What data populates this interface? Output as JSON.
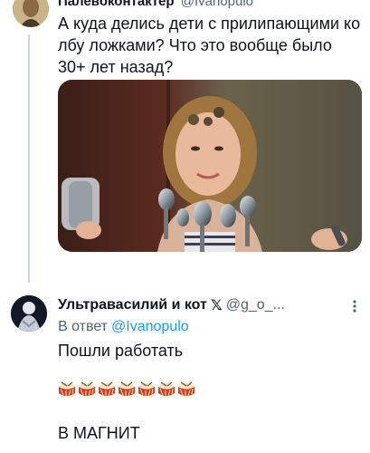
{
  "tweet1": {
    "display_name": "Палевоконтактер",
    "handle": "@Ivanopulo",
    "text": "А куда делись дети с прилипающими ко лбу ложками? Что это вообще было 30+ лет назад?"
  },
  "tweet2": {
    "display_name": "Ультравасилий и кот",
    "badge": "𝕏",
    "handle": "@g_o_...",
    "reply_to_label": "В ответ",
    "reply_to_handle": "@Ivanopulo",
    "text_line1": "Пошли работать",
    "emoji": [
      "drum",
      "drum",
      "drum",
      "drum",
      "drum",
      "drum",
      "drum"
    ],
    "text_line2": "В МАГНИТ"
  },
  "icons": {
    "more": "more-vertical-icon"
  },
  "colors": {
    "text": "#0f1419",
    "secondary": "#536471",
    "link": "#1d9bf0",
    "thread_line": "#cfd9de"
  }
}
